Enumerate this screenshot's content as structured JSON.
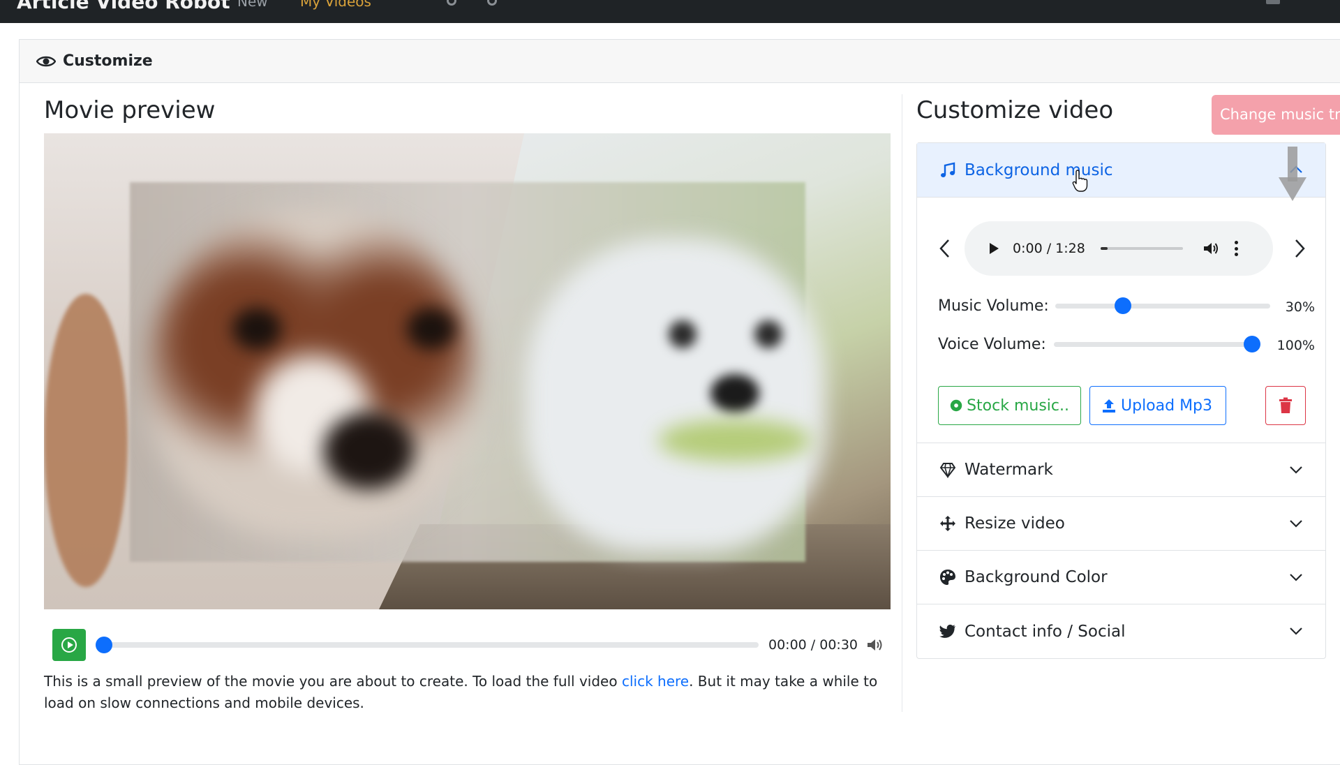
{
  "topbar": {
    "brand": "Article Video Robot",
    "nav_new": "New",
    "nav_my_videos": "My Videos"
  },
  "card": {
    "header_title": "Customize"
  },
  "preview": {
    "heading": "Movie preview",
    "time": "00:00 / 00:30",
    "progress": 0,
    "description_before": "This is a small preview of the movie you are about to create. To load the full video ",
    "description_link": "click here",
    "description_after": ". But it may take a while to load on slow connections and mobile devices."
  },
  "customize": {
    "heading": "Customize video",
    "change_music_button": "Change music track",
    "background_music": {
      "label": "Background music",
      "audio_time": "0:00 / 1:28",
      "music_volume_label": "Music Volume:",
      "music_volume": "30%",
      "music_volume_value": 30,
      "voice_volume_label": "Voice Volume:",
      "voice_volume": "100%",
      "voice_volume_value": 100,
      "stock_music_button": "Stock music..",
      "upload_button": "Upload Mp3"
    },
    "sections": [
      {
        "label": "Watermark",
        "icon": "diamond-icon"
      },
      {
        "label": "Resize video",
        "icon": "move-arrows-icon"
      },
      {
        "label": "Background Color",
        "icon": "palette-icon"
      },
      {
        "label": "Contact info / Social",
        "icon": "twitter-icon"
      }
    ]
  },
  "colors": {
    "primary": "#0d6efd",
    "success": "#28a745",
    "danger": "#dc3545",
    "active_bg": "#e8f1fe",
    "change_button": "#f4a1ab"
  }
}
